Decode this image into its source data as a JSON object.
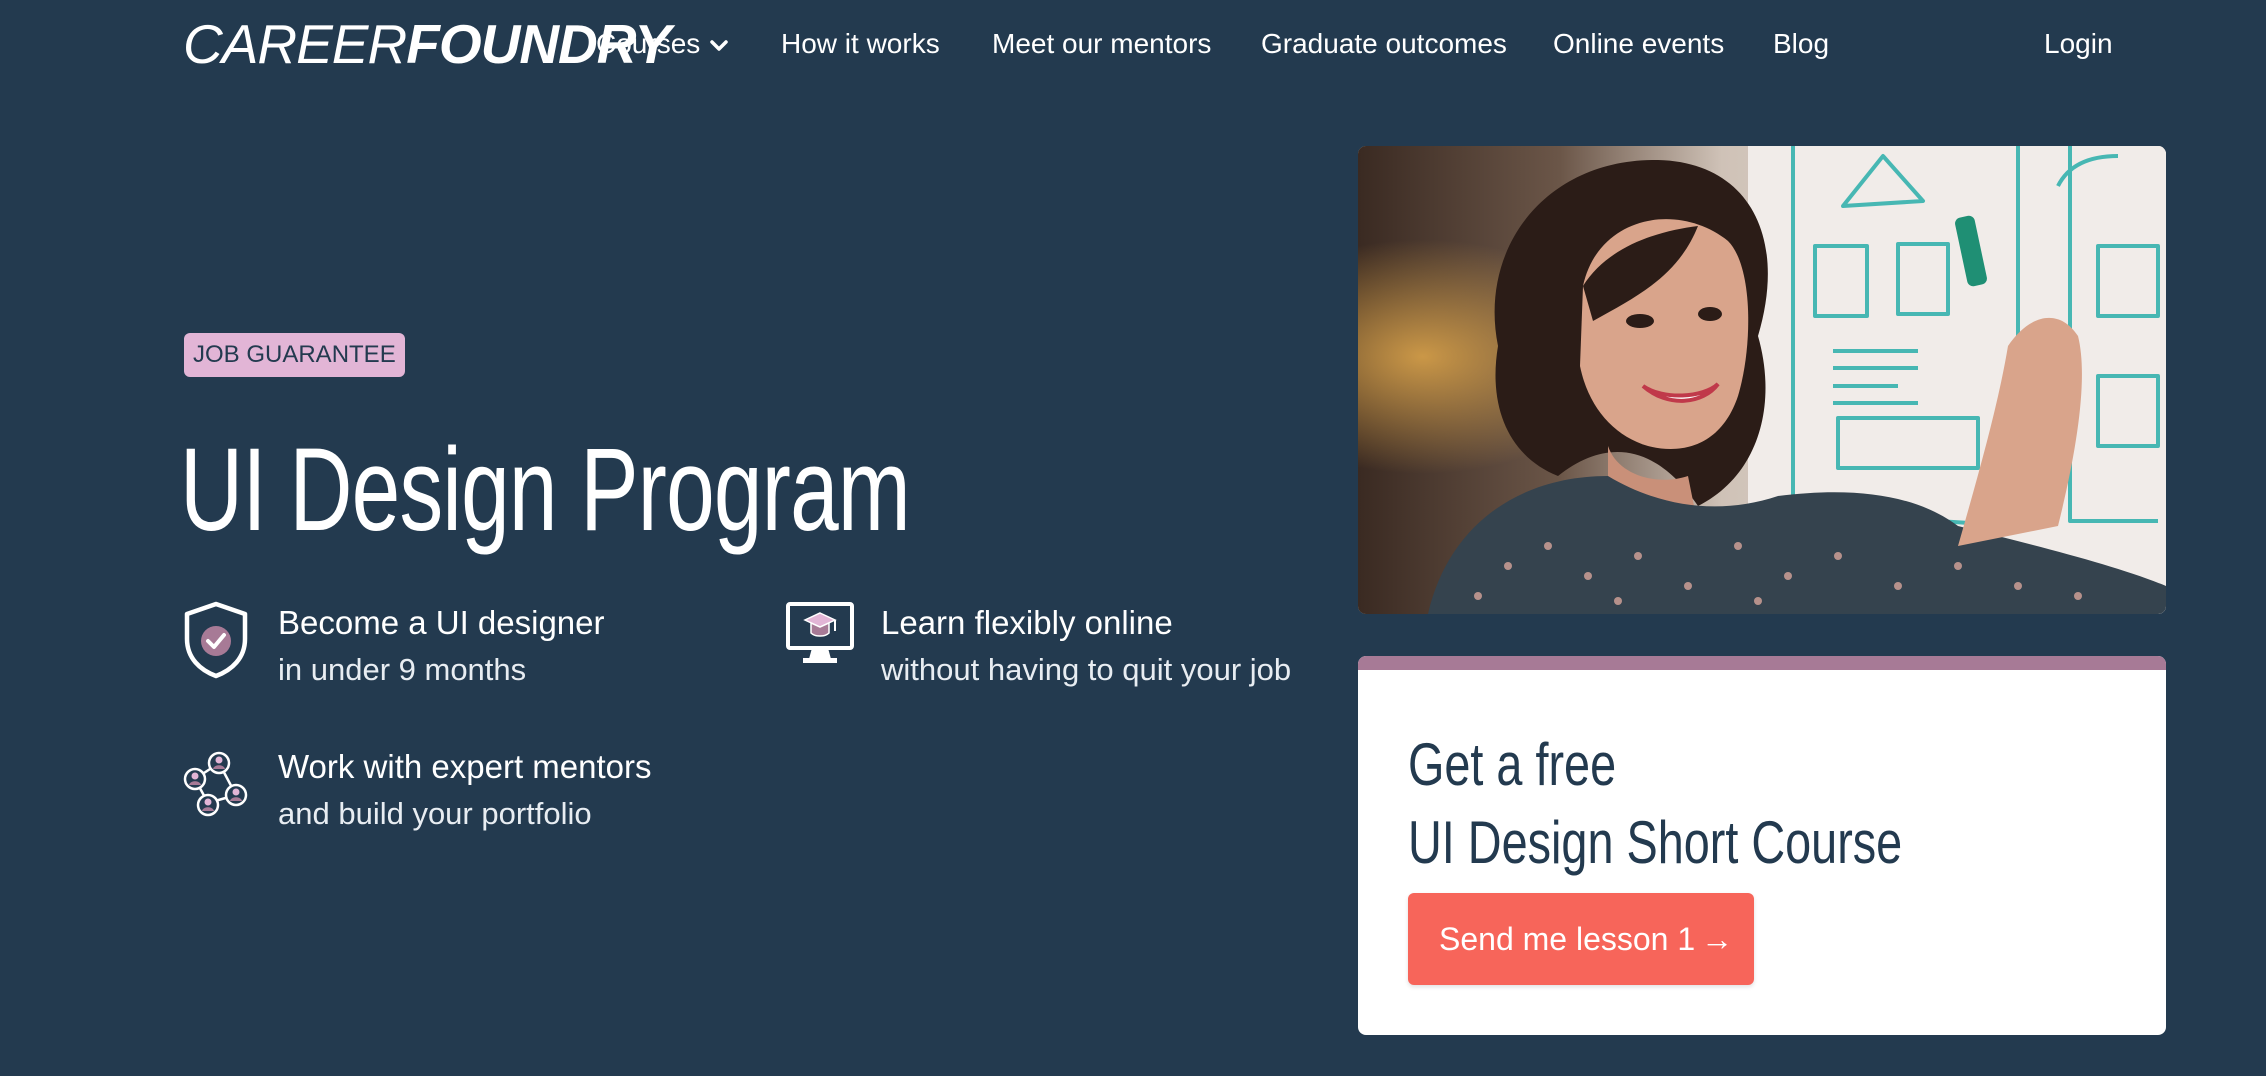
{
  "brand": {
    "logo_light": "CAREER",
    "logo_bold": "FOUNDRY"
  },
  "nav": {
    "courses": "Courses",
    "how_it_works": "How it works",
    "mentors": "Meet our mentors",
    "outcomes": "Graduate outcomes",
    "events": "Online events",
    "blog": "Blog",
    "login": "Login"
  },
  "hero": {
    "badge": "JOB GUARANTEE",
    "title": "UI Design Program",
    "features": [
      {
        "icon": "shield-check-icon",
        "title": "Become a UI designer",
        "subtitle": "in under 9 months"
      },
      {
        "icon": "monitor-graduation-icon",
        "title": "Learn flexibly online",
        "subtitle": "without having to quit your job"
      },
      {
        "icon": "mentor-network-icon",
        "title": "Work with expert mentors",
        "subtitle": "and build your portfolio"
      }
    ]
  },
  "offer": {
    "title_line1": "Get a free",
    "title_line2": "UI Design Short Course",
    "button_label": "Send me lesson 1",
    "button_arrow": "→"
  },
  "colors": {
    "background": "#233a4f",
    "badge": "#e2b5d6",
    "card_accent": "#a77a96",
    "cta": "#f7655a"
  }
}
